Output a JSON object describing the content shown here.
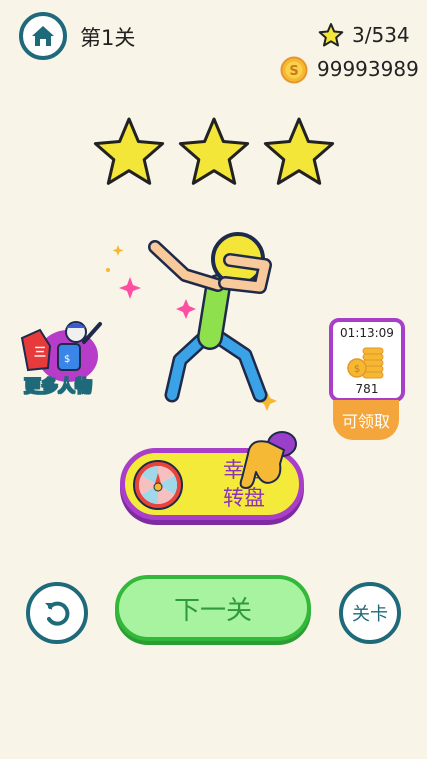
{
  "header": {
    "level_title": "第1关",
    "stars_count": "3/534",
    "coins_count": "99993989"
  },
  "result": {
    "stars_earned": 3,
    "stars_total": 3
  },
  "side_left": {
    "more_characters_label": "更多人物"
  },
  "side_right": {
    "timer": "01:13:09",
    "reward_amount": "781",
    "claim_label": "可领取"
  },
  "lucky_wheel": {
    "label": "幸运转盘"
  },
  "footer": {
    "next_label": "下一关",
    "levels_label": "关卡"
  },
  "colors": {
    "background": "#f8f4e8",
    "teal": "#1e6a7a",
    "star_yellow": "#f4e638",
    "purple": "#a93fc9",
    "green": "#33b83a",
    "orange": "#f4a63c"
  }
}
